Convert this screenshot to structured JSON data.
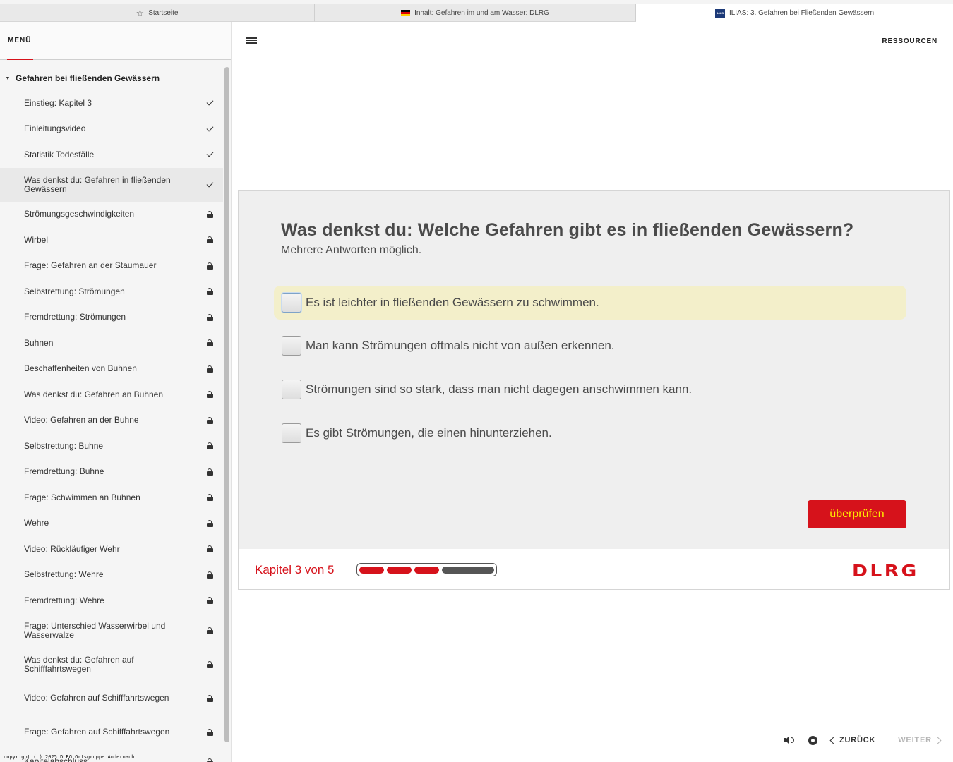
{
  "browser": {
    "tabs": [
      {
        "label": "Startseite",
        "icon": "star-icon"
      },
      {
        "label": "Inhalt: Gefahren im und am Wasser: DLRG",
        "icon": "german-flag-icon"
      },
      {
        "label": "ILIAS: 3. Gefahren bei Fließenden Gewässern",
        "icon": "ilias-icon"
      }
    ]
  },
  "sidebar": {
    "menu_label": "MENÜ",
    "section_title": "Gefahren bei fließenden Gewässern",
    "items": [
      {
        "label": "Einstieg: Kapitel 3",
        "status": "done"
      },
      {
        "label": "Einleitungsvideo",
        "status": "done"
      },
      {
        "label": "Statistik Todesfälle",
        "status": "done"
      },
      {
        "label": "Was denkst du: Gefahren in fließenden Gewässern",
        "status": "done"
      },
      {
        "label": "Strömungsgeschwindigkeiten",
        "status": "locked"
      },
      {
        "label": "Wirbel",
        "status": "locked"
      },
      {
        "label": "Frage: Gefahren an der Staumauer",
        "status": "locked"
      },
      {
        "label": "Selbstrettung: Strömungen",
        "status": "locked"
      },
      {
        "label": "Fremdrettung: Strömungen",
        "status": "locked"
      },
      {
        "label": "Buhnen",
        "status": "locked"
      },
      {
        "label": "Beschaffenheiten von Buhnen",
        "status": "locked"
      },
      {
        "label": "Was denkst du: Gefahren an Buhnen",
        "status": "locked"
      },
      {
        "label": "Video: Gefahren an der Buhne",
        "status": "locked"
      },
      {
        "label": "Selbstrettung: Buhne",
        "status": "locked"
      },
      {
        "label": "Fremdrettung: Buhne",
        "status": "locked"
      },
      {
        "label": "Frage: Schwimmen an Buhnen",
        "status": "locked"
      },
      {
        "label": "Wehre",
        "status": "locked"
      },
      {
        "label": "Video: Rückläufiger Wehr",
        "status": "locked"
      },
      {
        "label": "Selbstrettung: Wehre",
        "status": "locked"
      },
      {
        "label": "Fremdrettung: Wehre",
        "status": "locked"
      },
      {
        "label": "Frage: Unterschied Wasserwirbel und Wasserwalze",
        "status": "locked"
      },
      {
        "label": "Was denkst du: Gefahren auf Schifffahrtswegen",
        "status": "locked"
      },
      {
        "label": "Video: Gefahren auf Schifffahrtswegen",
        "status": "locked"
      },
      {
        "label": "Frage: Gefahren auf Schifffahrtswegen",
        "status": "locked"
      },
      {
        "label": "Kapitelabschluss",
        "status": "locked"
      }
    ],
    "copyright": "copyright (c) 2025 DLRG Ortsgruppe Andernach"
  },
  "header": {
    "resources_label": "RESSOURCEN"
  },
  "question": {
    "title": "Was denkst du: Welche Gefahren gibt es in fließenden Gewässern?",
    "subtitle": "Mehrere Antworten möglich.",
    "answers": [
      {
        "text": "Es ist leichter in fließenden Gewässern zu schwimmen.",
        "checked": false
      },
      {
        "text": "Man kann Strömungen oftmals nicht von außen erkennen.",
        "checked": false
      },
      {
        "text": "Strömungen sind so stark, dass man nicht dagegen anschwimmen kann.",
        "checked": false
      },
      {
        "text": "Es gibt Strömungen, die einen hinunterziehen.",
        "checked": false
      }
    ],
    "check_label": "überprüfen"
  },
  "footer": {
    "chapter_label": "Kapitel 3 von 5",
    "progress_completed": 3,
    "progress_total": 5,
    "logo_text": "DLRG",
    "brand_color": "#d6121b",
    "button_text_color": "#ffed00"
  },
  "controls": {
    "back_label": "ZURÜCK",
    "next_label": "WEITER"
  }
}
